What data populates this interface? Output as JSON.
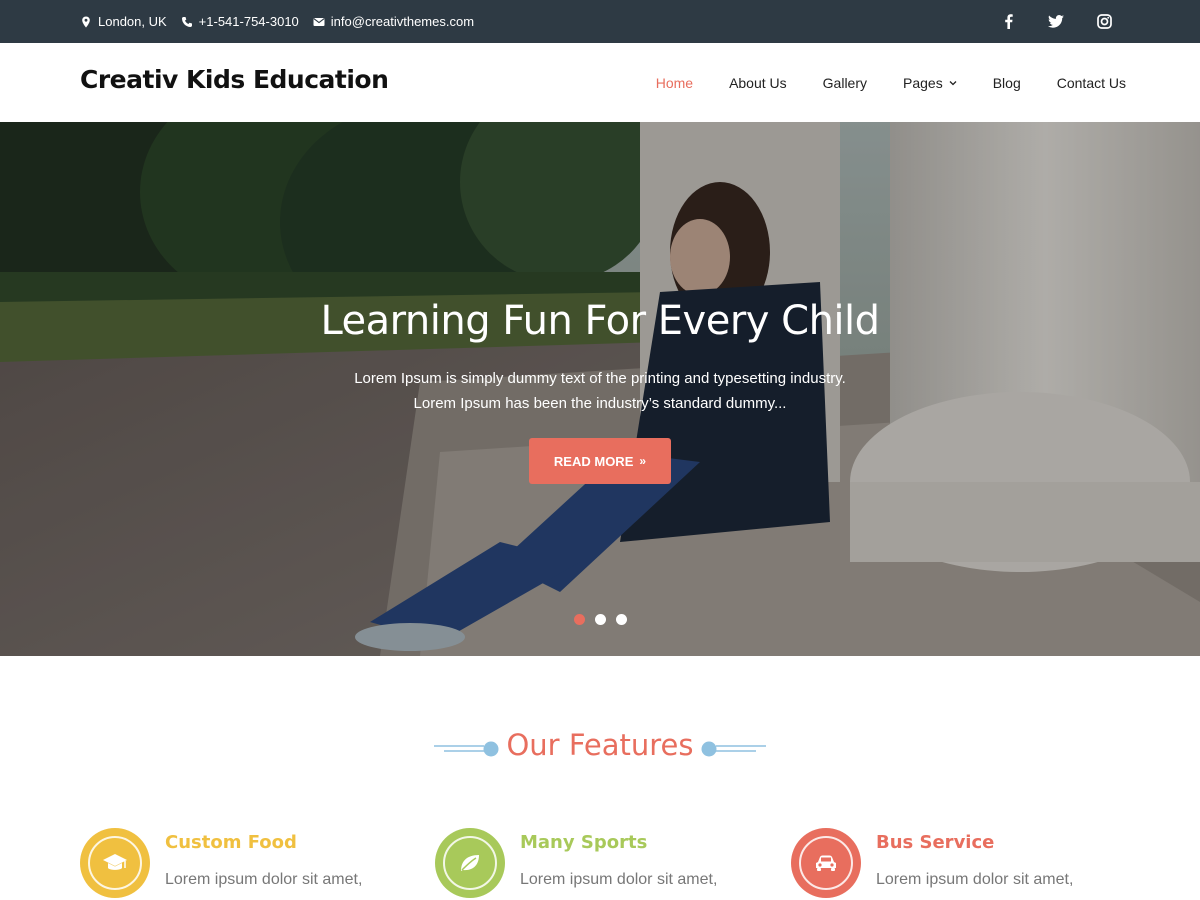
{
  "topbar": {
    "location": "London, UK",
    "phone": "+1-541-754-3010",
    "email": "info@creativthemes.com",
    "social": [
      "facebook-icon",
      "twitter-icon",
      "instagram-icon"
    ]
  },
  "header": {
    "logo": "Creativ Kids Education",
    "nav": [
      {
        "label": "Home",
        "active": true
      },
      {
        "label": "About Us"
      },
      {
        "label": "Gallery"
      },
      {
        "label": "Pages",
        "has_dropdown": true
      },
      {
        "label": "Blog"
      },
      {
        "label": "Contact Us"
      }
    ]
  },
  "hero": {
    "title": "Learning Fun For Every Child",
    "text": "Lorem Ipsum is simply dummy text of the printing and typesetting industry. Lorem Ipsum has been the industry’s standard dummy...",
    "button": "READ MORE",
    "slides": 3,
    "active_slide": 1
  },
  "features": {
    "title": "Our Features",
    "items": [
      {
        "title": "Custom Food",
        "text": "Lorem ipsum dolor sit amet,",
        "color": "#f0c040",
        "icon": "graduation-cap-icon"
      },
      {
        "title": "Many Sports",
        "text": "Lorem ipsum dolor sit amet,",
        "color": "#a8c95a",
        "icon": "leaf-icon"
      },
      {
        "title": "Bus Service",
        "text": "Lorem ipsum dolor sit amet,",
        "color": "#e86e5e",
        "icon": "car-icon"
      }
    ]
  },
  "colors": {
    "accent": "#e86e5e",
    "topbar": "#2e3a44",
    "deco": "#8fc1e0"
  }
}
